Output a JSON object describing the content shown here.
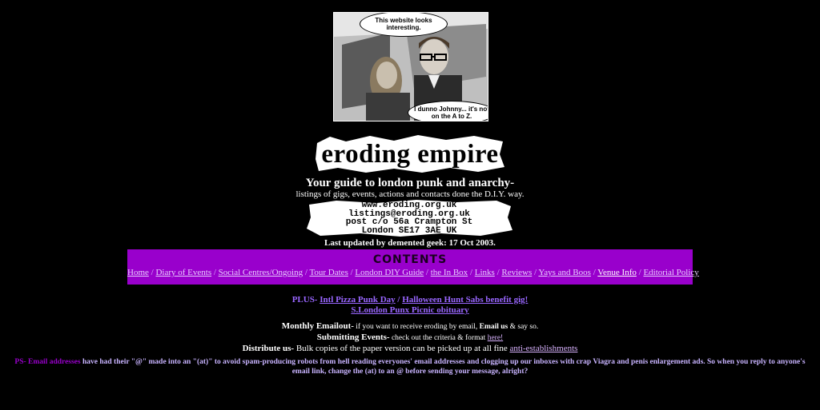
{
  "hero": {
    "bubble_top": "This website looks interesting.",
    "bubble_bottom": "I dunno Johnny... it's not on the A to Z."
  },
  "logo": {
    "text": "eroding empire"
  },
  "tagline": "Your guide to london punk and anarchy-",
  "subline": "listings of gigs, events, actions and contacts done the D.I.Y. way.",
  "address": {
    "line1": "www.eroding.org.uk",
    "line2": "listings@eroding.org.uk",
    "line3": "post c/o 56a Crampton St",
    "line4": "London SE17 3AE UK"
  },
  "updated": "Last updated by demented geek: 17 Oct 2003.",
  "contents": {
    "title": "Contents",
    "links": [
      "Home",
      "Diary of Events",
      "Social Centres/Ongoing",
      "Tour Dates",
      "London DIY Guide",
      "the In Box",
      "Links",
      "Reviews",
      "Yays and Boos",
      "Venue Info",
      "Editorial Policy"
    ]
  },
  "plus": {
    "label": "PLUS-",
    "link1": "Intl Pizza Punk Day",
    "sep": "/",
    "link2": "Halloween Hunt Sabs benefit gig!",
    "link3": "S.London Punx Picnic obituary"
  },
  "info": {
    "emailout_label": "Monthly Emailout-",
    "emailout_text": " if you want to receive eroding by email, ",
    "emailout_bold": "Email us",
    "emailout_tail": " & say so.",
    "submit_label": "Submitting Events-",
    "submit_text": " check out the criteria & format ",
    "submit_link": "here!",
    "distribute_label": "Distribute us-",
    "distribute_text": " Bulk copies of the paper version can be picked up at all fine ",
    "distribute_link": "anti-establishments"
  },
  "ps": {
    "label": "PS- Email addresses",
    "text": " have had their \"@\" made into an \"(at)\" to avoid spam-producing robots from hell reading everyones' email addresses and clogging up our inboxes with crap Viagra and penis enlargement ads. So when you reply to anyone's email link, change the (at) to an @ before sending your message, alright?"
  },
  "colors": {
    "background": "#000000",
    "contents_box": "#9900cc",
    "plus_text": "#9966ff"
  }
}
